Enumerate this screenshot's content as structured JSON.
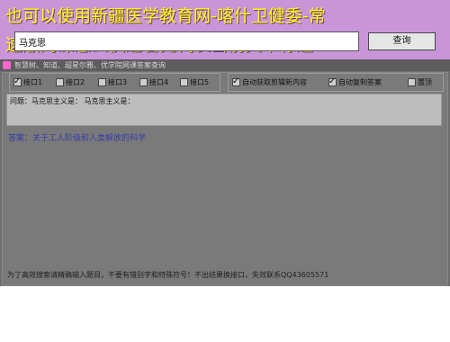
{
  "banner": {
    "line1": "也可以使用新疆医学教育网-喀什卫健委-常",
    "line2": "速版网课怎么快速看完代表当前文章标题"
  },
  "window": {
    "title": "智慧树、知道、超星尔雅、优学院网课答案查询"
  },
  "search": {
    "value": "马克思",
    "button_label": "查询"
  },
  "options": {
    "interfaces": [
      {
        "label": "接口1",
        "checked": true
      },
      {
        "label": "接口2",
        "checked": false
      },
      {
        "label": "接口3",
        "checked": false
      },
      {
        "label": "接口4",
        "checked": false
      },
      {
        "label": "接口5",
        "checked": false
      }
    ],
    "auto_get": {
      "label": "自动获取剪辑新内容",
      "checked": true
    },
    "auto_copy": {
      "label": "自动复制答案",
      "checked": true
    },
    "pin_top": {
      "label": "置顶",
      "checked": false
    }
  },
  "result": {
    "question": "问题：马克思主义是：  马克思主义是：",
    "answer": "答案：关于工人阶级和人类解放的科学"
  },
  "status_bar": {
    "text": "为了高效搜索请精确输入题目，不要有错别字和特殊符号！不出结果换接口，失效联系QQ43605571"
  }
}
